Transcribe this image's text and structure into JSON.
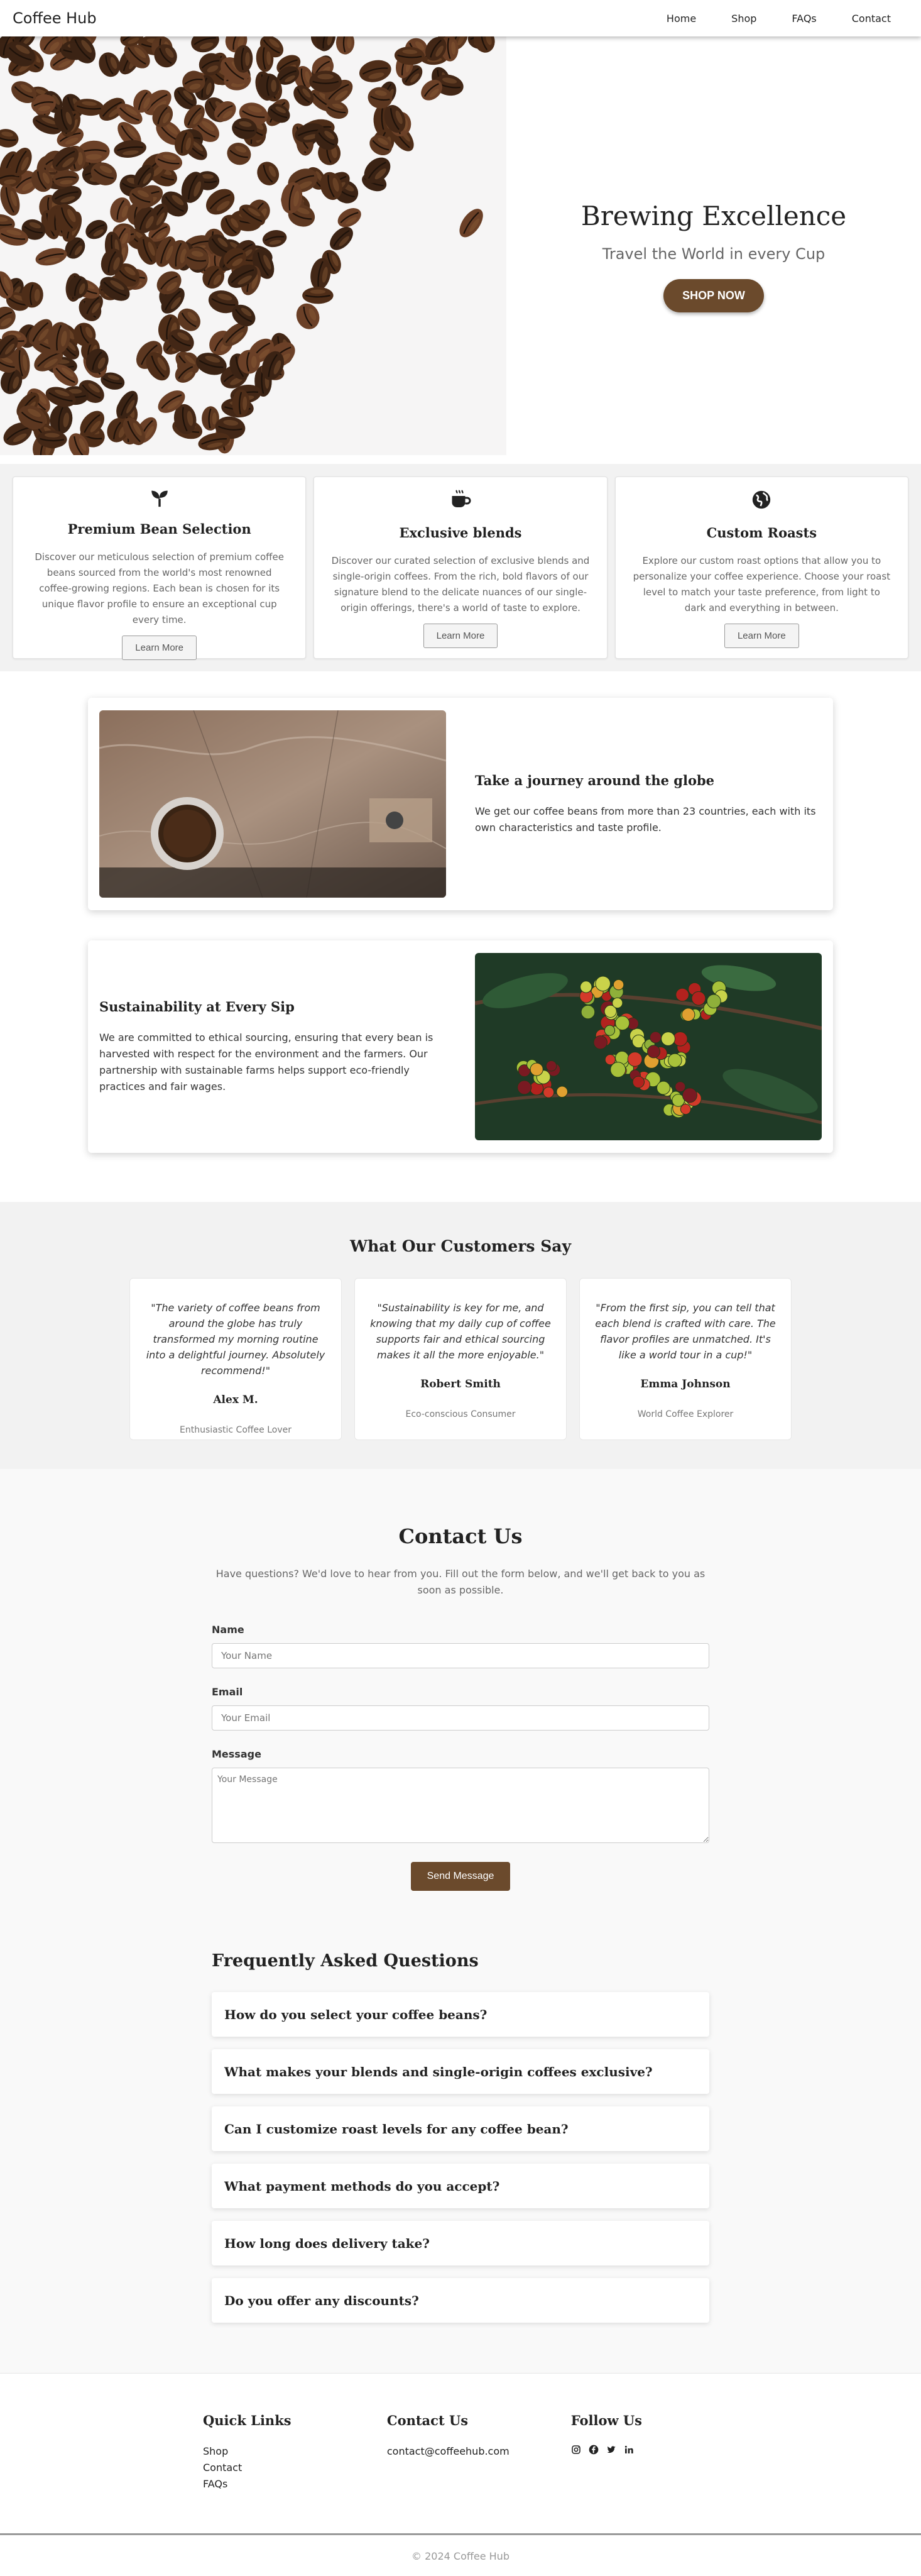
{
  "nav": {
    "brand": "Coffee Hub",
    "links": [
      "Home",
      "Shop",
      "FAQs",
      "Contact"
    ]
  },
  "hero": {
    "title": "Brewing Excellence",
    "subtitle": "Travel the World in every Cup",
    "cta": "SHOP NOW"
  },
  "features": [
    {
      "icon": "seedling-icon",
      "title": "Premium Bean Selection",
      "desc": "Discover our meticulous selection of premium coffee beans sourced from the world's most renowned coffee-growing regions. Each bean is chosen for its unique flavor profile to ensure an exceptional cup every time.",
      "button": "Learn More"
    },
    {
      "icon": "mug-icon",
      "title": "Exclusive blends",
      "desc": "Discover our curated selection of exclusive blends and single-origin coffees. From the rich, bold flavors of our signature blend to the delicate nuances of our single-origin offerings, there's a world of taste to explore.",
      "button": "Learn More"
    },
    {
      "icon": "globe-icon",
      "title": "Custom Roasts",
      "desc": "Explore our custom roast options that allow you to personalize your coffee experience. Choose your roast level to match your taste preference, from light to dark and everything in between.",
      "button": "Learn More"
    }
  ],
  "stories": [
    {
      "title": "Take a journey around the globe",
      "desc": "We get our coffee beans from more than 23 countries, each with its own characteristics and taste profile."
    },
    {
      "title": "Sustainability at Every Sip",
      "desc": "We are committed to ethical sourcing, ensuring that every bean is harvested with respect for the environment and the farmers. Our partnership with sustainable farms helps support eco-friendly practices and fair wages."
    }
  ],
  "testimonials": {
    "heading": "What Our Customers Say",
    "items": [
      {
        "quote": "\"The variety of coffee beans from around the globe has truly transformed my morning routine into a delightful journey. Absolutely recommend!\"",
        "name": "Alex M.",
        "role": "Enthusiastic Coffee Lover"
      },
      {
        "quote": "\"Sustainability is key for me, and knowing that my daily cup of coffee supports fair and ethical sourcing makes it all the more enjoyable.\"",
        "name": "Robert Smith",
        "role": "Eco-conscious Consumer"
      },
      {
        "quote": "\"From the first sip, you can tell that each blend is crafted with care. The flavor profiles are unmatched. It's like a world tour in a cup!\"",
        "name": "Emma Johnson",
        "role": "World Coffee Explorer"
      }
    ]
  },
  "contact": {
    "heading": "Contact Us",
    "intro": "Have questions? We'd love to hear from you. Fill out the form below, and we'll get back to you as soon as possible.",
    "name_label": "Name",
    "name_placeholder": "Your Name",
    "email_label": "Email",
    "email_placeholder": "Your Email",
    "message_label": "Message",
    "message_placeholder": "Your Message",
    "send": "Send Message"
  },
  "faq": {
    "heading": "Frequently Asked Questions",
    "items": [
      "How do you select your coffee beans?",
      "What makes your blends and single-origin coffees exclusive?",
      "Can I customize roast levels for any coffee bean?",
      "What payment methods do you accept?",
      "How long does delivery take?",
      "Do you offer any discounts?"
    ]
  },
  "footer": {
    "quick_links_heading": "Quick Links",
    "quick_links": [
      "Shop",
      "Contact",
      "FAQs"
    ],
    "contact_heading": "Contact Us",
    "email": "contact@coffeehub.com",
    "follow_heading": "Follow Us",
    "socials": [
      "instagram-icon",
      "facebook-icon",
      "twitter-icon",
      "linkedin-icon"
    ],
    "copyright": "© 2024 Coffee Hub"
  },
  "colors": {
    "accent": "#6b4a2c",
    "section_bg": "#f2f2f2"
  }
}
